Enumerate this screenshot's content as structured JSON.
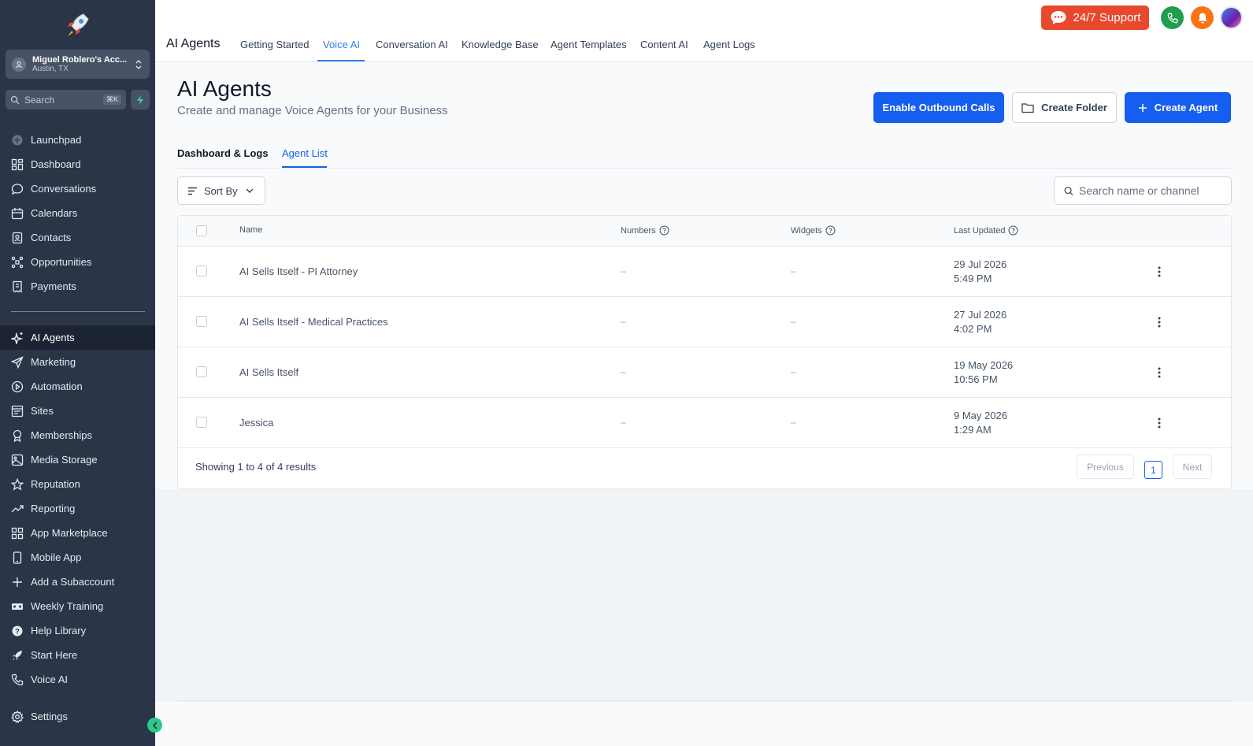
{
  "sidebar": {
    "account": {
      "name": "Miguel Roblero's Acc...",
      "location": "Austin, TX"
    },
    "search": {
      "placeholder": "Search",
      "shortcut": "⌘K"
    },
    "items_top": [
      {
        "label": "Launchpad",
        "icon": "launchpad-icon"
      },
      {
        "label": "Dashboard",
        "icon": "dashboard-icon"
      },
      {
        "label": "Conversations",
        "icon": "chat-icon"
      },
      {
        "label": "Calendars",
        "icon": "calendar-icon"
      },
      {
        "label": "Contacts",
        "icon": "contacts-icon"
      },
      {
        "label": "Opportunities",
        "icon": "opportunities-icon"
      },
      {
        "label": "Payments",
        "icon": "payments-icon"
      }
    ],
    "items_bottom": [
      {
        "label": "AI Agents",
        "icon": "sparkle-icon",
        "active": true
      },
      {
        "label": "Marketing",
        "icon": "send-icon"
      },
      {
        "label": "Automation",
        "icon": "automation-icon"
      },
      {
        "label": "Sites",
        "icon": "sites-icon"
      },
      {
        "label": "Memberships",
        "icon": "award-icon"
      },
      {
        "label": "Media Storage",
        "icon": "image-icon"
      },
      {
        "label": "Reputation",
        "icon": "star-icon"
      },
      {
        "label": "Reporting",
        "icon": "trend-icon"
      },
      {
        "label": "App Marketplace",
        "icon": "grid-icon"
      },
      {
        "label": "Mobile App",
        "icon": "mobile-icon"
      },
      {
        "label": "Add a Subaccount",
        "icon": "plus-icon"
      },
      {
        "label": "Weekly Training",
        "icon": "training-icon"
      },
      {
        "label": "Help Library",
        "icon": "help-icon"
      },
      {
        "label": "Start Here",
        "icon": "rocket-icon"
      },
      {
        "label": "Voice AI",
        "icon": "phone-icon"
      }
    ],
    "settings": "Settings"
  },
  "header": {
    "app_title": "AI Agents",
    "tabs": [
      {
        "label": "Getting Started"
      },
      {
        "label": "Voice AI",
        "active": true
      },
      {
        "label": "Conversation AI"
      },
      {
        "label": "Knowledge Base"
      },
      {
        "label": "Agent Templates"
      },
      {
        "label": "Content AI"
      },
      {
        "label": "Agent Logs"
      }
    ],
    "support_label": "24/7 Support"
  },
  "page": {
    "title": "AI Agents",
    "subtitle": "Create and manage Voice Agents for your Business",
    "buttons": {
      "outbound": "Enable Outbound Calls",
      "folder": "Create Folder",
      "agent": "Create Agent"
    },
    "subtabs": [
      "Dashboard & Logs",
      "Agent List"
    ]
  },
  "table": {
    "sort_label": "Sort By",
    "search_placeholder": "Search name or channel",
    "columns": {
      "name": "Name",
      "numbers": "Numbers",
      "widgets": "Widgets",
      "updated": "Last Updated"
    },
    "rows": [
      {
        "name": "AI Sells Itself - PI Attorney",
        "numbers": "–",
        "widgets": "–",
        "date": "29 Jul 2026",
        "time": "5:49 PM"
      },
      {
        "name": "AI Sells Itself - Medical Practices",
        "numbers": "–",
        "widgets": "–",
        "date": "27 Jul 2026",
        "time": "4:02 PM"
      },
      {
        "name": "AI Sells Itself",
        "numbers": "–",
        "widgets": "–",
        "date": "19 May 2026",
        "time": "10:56 PM"
      },
      {
        "name": "Jessica",
        "numbers": "–",
        "widgets": "–",
        "date": "9 May 2026",
        "time": "1:29 AM"
      }
    ],
    "footer": "Showing 1 to 4 of 4 results",
    "pagination": {
      "prev": "Previous",
      "current": "1",
      "next": "Next"
    }
  },
  "colors": {
    "sidebar_bg": "#2b3548",
    "primary": "#155eef",
    "accent_tab": "#2f80ed",
    "support": "#e8492c",
    "phone": "#1e9e4a",
    "bell": "#f97316"
  }
}
